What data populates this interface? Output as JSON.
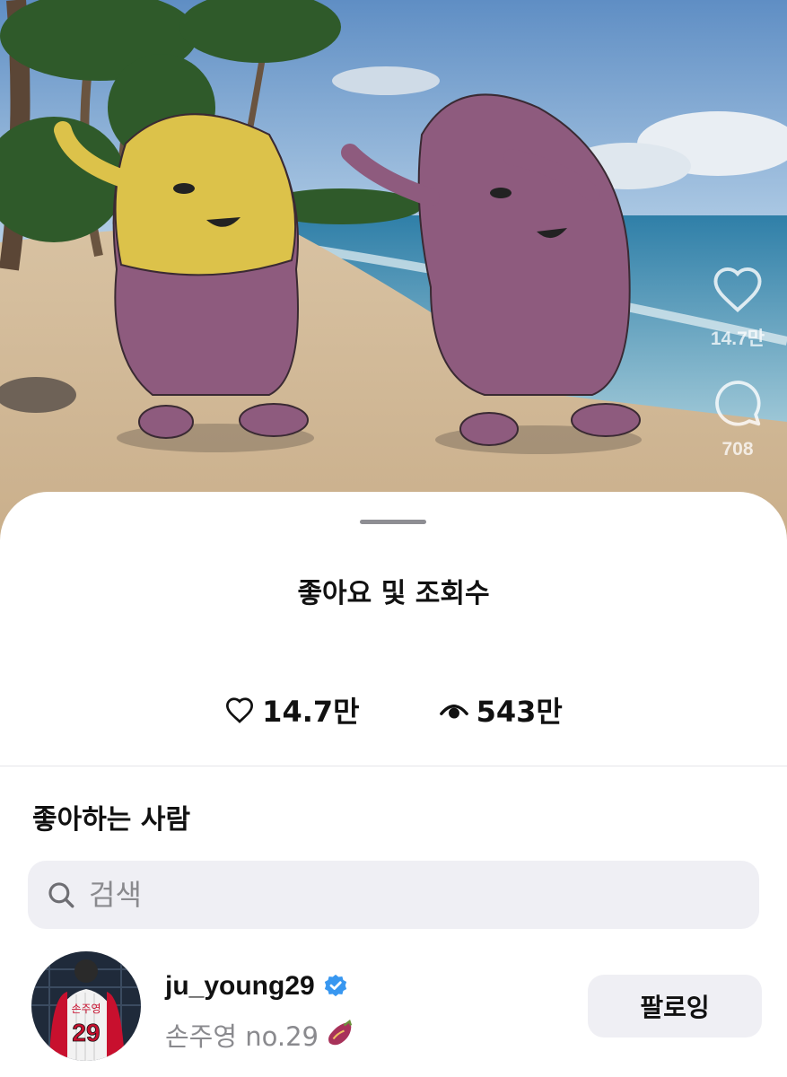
{
  "video_rail": {
    "like_count": "14.7만",
    "comment_count": "708"
  },
  "sheet": {
    "title": "좋아요 및 조회수",
    "likes": "14.7만",
    "views": "543만",
    "section_title": "좋아하는 사람",
    "search_placeholder": "검색"
  },
  "users": [
    {
      "username": "ju_young29",
      "verified": true,
      "bio": "손주영 no.29",
      "jersey_name": "손주영",
      "jersey_number": "29",
      "follow_label": "팔로잉"
    }
  ],
  "icons": {
    "like": "heart-icon",
    "comment": "comment-icon",
    "views": "eye-icon",
    "search": "search-icon",
    "verified": "verified-badge-icon",
    "bio_emoji": "sweet-potato-icon"
  },
  "colors": {
    "accent_verified": "#3897f0",
    "sheet_bg": "#ffffff",
    "field_bg": "#efeff4"
  }
}
